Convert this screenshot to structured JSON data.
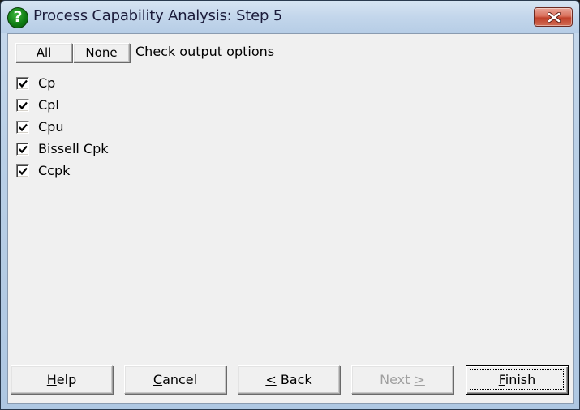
{
  "window": {
    "title": "Process Capability Analysis: Step 5",
    "icon": "question-icon",
    "close_icon": "close-icon"
  },
  "toolbar": {
    "all_label": "All",
    "none_label": "None",
    "header_text": "Check output options"
  },
  "options": [
    {
      "label": "Cp",
      "checked": true
    },
    {
      "label": "Cpl",
      "checked": true
    },
    {
      "label": "Cpu",
      "checked": true
    },
    {
      "label": "Bissell Cpk",
      "checked": true
    },
    {
      "label": "Ccpk",
      "checked": true
    }
  ],
  "footer": {
    "help": {
      "mnemonic": "H",
      "rest": "elp"
    },
    "cancel": {
      "mnemonic": "C",
      "rest": "ancel"
    },
    "back": {
      "mnemonic": "<",
      "rest": " Back"
    },
    "next": {
      "pre": "Next ",
      "mnemonic": ">",
      "disabled": true
    },
    "finish": {
      "mnemonic": "F",
      "rest": "inish",
      "default": true
    }
  },
  "colors": {
    "dialog_bg": "#f0f0f0",
    "icon_green": "#0e7a12",
    "close_red": "#c0412a",
    "disabled_text": "#a0a0a0"
  }
}
